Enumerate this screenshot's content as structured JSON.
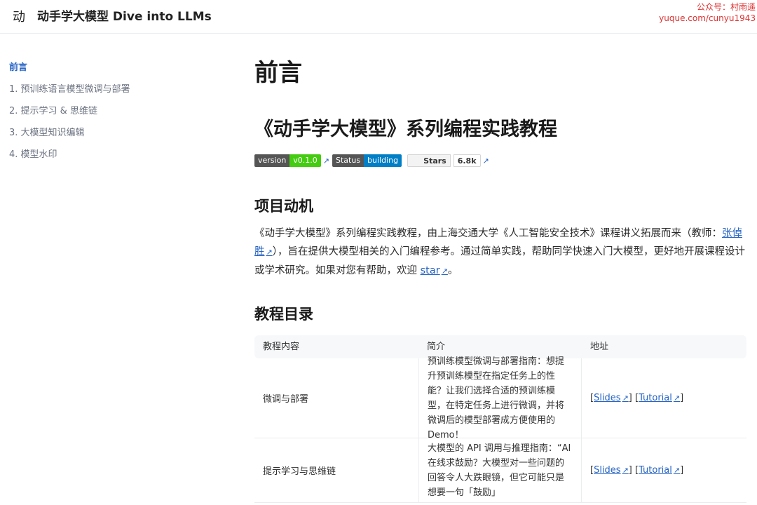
{
  "header": {
    "logo_char": "动",
    "title": "动手学大模型 Dive into LLMs",
    "watermark_line1": "公众号：村雨遥",
    "watermark_line2": "yuque.com/cunyu1943"
  },
  "sidebar": {
    "items": [
      {
        "label": "前言"
      },
      {
        "label": "1. 预训练语言模型微调与部署"
      },
      {
        "label": "2. 提示学习 & 思维链"
      },
      {
        "label": "3. 大模型知识编辑"
      },
      {
        "label": "4. 模型水印"
      }
    ]
  },
  "main": {
    "title": "前言",
    "subtitle": "《动手学大模型》系列编程实践教程",
    "badges": {
      "version_label": "version",
      "version_value": "v0.1.0",
      "status_label": "Status",
      "status_value": "building",
      "stars_label": "Stars",
      "stars_count": "6.8k"
    },
    "motivation_heading": "项目动机",
    "motivation_text_1": "《动手学大模型》系列编程实践教程，由上海交通大学《人工智能安全技术》课程讲义拓展而来（教师：",
    "motivation_link_teacher": "张倬胜",
    "motivation_text_2": "），旨在提供大模型相关的入门编程参考。通过简单实践，帮助同学快速入门大模型，更好地开展课程设计或学术研究。如果对您有帮助，欢迎",
    "motivation_link_star": "star",
    "motivation_text_3": "。",
    "toc_heading": "教程目录",
    "table": {
      "headers": [
        "教程内容",
        "简介",
        "地址"
      ],
      "rows": [
        {
          "content": "微调与部署",
          "intro": "预训练模型微调与部署指南：想提升预训练模型在指定任务上的性能？让我们选择合适的预训练模型，在特定任务上进行微调，并将微调后的模型部署成方便使用的 Demo！",
          "slides": "Slides",
          "tutorial": "Tutorial"
        },
        {
          "content": "提示学习与思维链",
          "intro": "大模型的 API 调用与推理指南：“AI在线求鼓励？大模型对一些问题的回答令人大跌眼镜，但它可能只是想要一句「鼓励」",
          "slides": "Slides",
          "tutorial": "Tutorial"
        }
      ]
    }
  },
  "colors": {
    "link": "#2563c4",
    "accent_green": "#44cc11",
    "accent_blue": "#007ec6",
    "watermark": "#e03030"
  }
}
